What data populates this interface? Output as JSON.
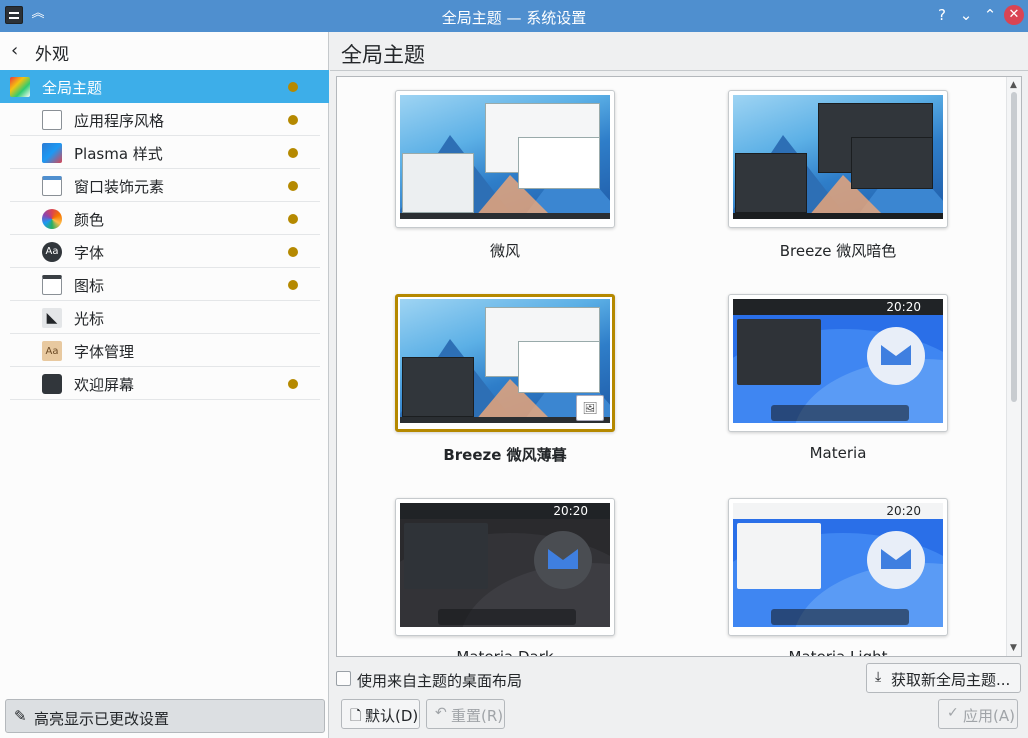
{
  "window": {
    "title": "全局主题 — 系统设置",
    "help": "?",
    "minimize": "⌄",
    "maximize": "⌃",
    "close": "✕"
  },
  "sidebar": {
    "back_label": "外观",
    "items": [
      {
        "label": "全局主题",
        "changed": true,
        "icon": "global-theme-icon"
      },
      {
        "label": "应用程序风格",
        "changed": true,
        "icon": "application-style-icon"
      },
      {
        "label": "Plasma 样式",
        "changed": true,
        "icon": "plasma-style-icon"
      },
      {
        "label": "窗口装饰元素",
        "changed": true,
        "icon": "window-decoration-icon"
      },
      {
        "label": "颜色",
        "changed": true,
        "icon": "colors-icon"
      },
      {
        "label": "字体",
        "changed": true,
        "icon": "fonts-icon"
      },
      {
        "label": "图标",
        "changed": true,
        "icon": "icons-icon"
      },
      {
        "label": "光标",
        "changed": false,
        "icon": "cursor-icon"
      },
      {
        "label": "字体管理",
        "changed": false,
        "icon": "font-management-icon"
      },
      {
        "label": "欢迎屏幕",
        "changed": true,
        "icon": "splash-screen-icon"
      }
    ],
    "highlight_button": "高亮显示已更改设置"
  },
  "main": {
    "title": "全局主题",
    "themes": [
      {
        "name": "微风",
        "selected": false
      },
      {
        "name": "Breeze 微风暗色",
        "selected": false
      },
      {
        "name": "Breeze 微风薄暮",
        "selected": true
      },
      {
        "name": "Materia",
        "selected": false
      },
      {
        "name": "Materia Dark",
        "selected": false
      },
      {
        "name": "Materia Light",
        "selected": false
      }
    ],
    "materia_clock": "20:20",
    "use_layout_checkbox": "使用来自主题的桌面布局",
    "get_new_button": "获取新全局主题...",
    "default_button": "默认(D)",
    "reset_button": "重置(R)",
    "apply_button": "应用(A)"
  },
  "colors": {
    "titlebar": "#4f8fcf",
    "selection": "#3daee9",
    "changed_dot": "#b58900",
    "close": "#da4453"
  }
}
